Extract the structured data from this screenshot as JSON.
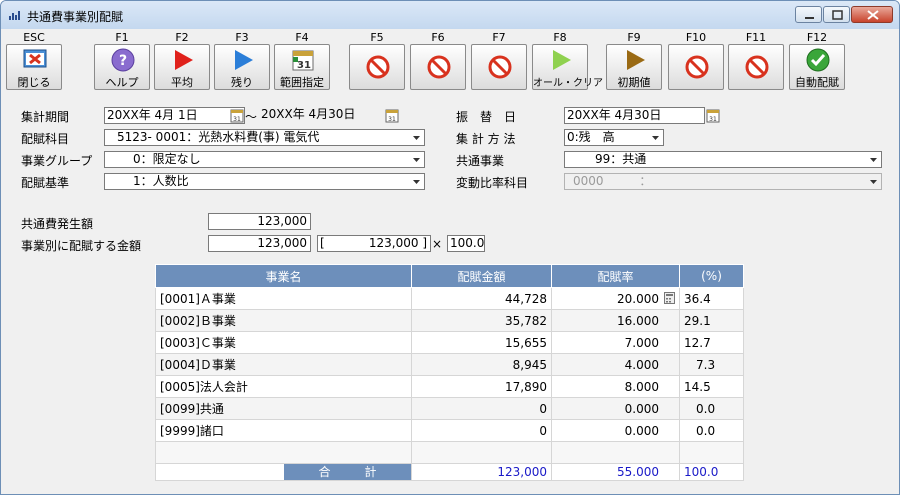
{
  "window": {
    "title": "共通費事業別配賦"
  },
  "toolbar": {
    "keys": [
      {
        "key": "ESC",
        "name": "閉じる",
        "icon": "close-window-icon"
      },
      {
        "key": "F1",
        "name": "ヘルプ",
        "icon": "help-icon"
      },
      {
        "key": "F2",
        "name": "平均",
        "icon": "play-icon"
      },
      {
        "key": "F3",
        "name": "残り",
        "icon": "play-icon"
      },
      {
        "key": "F4",
        "name": "範囲指定",
        "icon": "calendar-icon"
      },
      {
        "key": "F5",
        "name": "",
        "icon": "disabled-icon"
      },
      {
        "key": "F6",
        "name": "",
        "icon": "disabled-icon"
      },
      {
        "key": "F7",
        "name": "",
        "icon": "disabled-icon"
      },
      {
        "key": "F8",
        "name": "オール・クリア",
        "icon": "play-icon"
      },
      {
        "key": "F9",
        "name": "初期値",
        "icon": "play-icon"
      },
      {
        "key": "F10",
        "name": "",
        "icon": "disabled-icon"
      },
      {
        "key": "F11",
        "name": "",
        "icon": "disabled-icon"
      },
      {
        "key": "F12",
        "name": "自動配賦",
        "icon": "check-icon"
      }
    ],
    "colors": {
      "play_f2": "#e0211b",
      "play_f3": "#2b7ed8",
      "play_f8": "#8fd14f",
      "play_f9": "#9a6a14",
      "disabled": "#d8321e",
      "check": "#3aa63a"
    }
  },
  "form": {
    "period": {
      "label": "集計期間",
      "from": "20XX年 4月 1日",
      "to": "20XX年 4月30日"
    },
    "account": {
      "label": "配賦科目",
      "value": "5123- 0001：光熱水料費(事) 電気代"
    },
    "group": {
      "label": "事業グループ",
      "value": "0：限定なし"
    },
    "basis": {
      "label": "配賦基準",
      "value": "1：人数比"
    },
    "transfer_date": {
      "label": "振　替　日",
      "value": "20XX年 4月30日"
    },
    "method": {
      "label": "集 計 方 法",
      "value": "0:残　高"
    },
    "common_business": {
      "label": "共通事業",
      "value": "99：共通"
    },
    "variable_account": {
      "label": "変動比率科目",
      "code": "0000",
      "sep": "："
    },
    "common_amount": {
      "label": "共通費発生額",
      "value": "123,000"
    },
    "allocation_amount": {
      "label": "事業別に配賦する金額",
      "value": "123,000",
      "bracket_value": "123,000",
      "bracket_open": "[",
      "bracket_close": "]",
      "times": "×",
      "rate": "100.0"
    }
  },
  "table": {
    "headers": [
      "事業名",
      "配賦金額",
      "配賦率",
      "(%)"
    ],
    "rows": [
      {
        "name": "[0001]Ａ事業",
        "amount": "44,728",
        "rate": "20.000",
        "pct": "36.4"
      },
      {
        "name": "[0002]Ｂ事業",
        "amount": "35,782",
        "rate": "16.000",
        "pct": "29.1"
      },
      {
        "name": "[0003]Ｃ事業",
        "amount": "15,655",
        "rate": "7.000",
        "pct": "12.7"
      },
      {
        "name": "[0004]Ｄ事業",
        "amount": "8,945",
        "rate": "4.000",
        "pct": "7.3"
      },
      {
        "name": "[0005]法人会計",
        "amount": "17,890",
        "rate": "8.000",
        "pct": "14.5"
      },
      {
        "name": "[0099]共通",
        "amount": "0",
        "rate": "0.000",
        "pct": "0.0"
      },
      {
        "name": "[9999]諸口",
        "amount": "0",
        "rate": "0.000",
        "pct": "0.0"
      }
    ],
    "total": {
      "label": "合計",
      "amount": "123,000",
      "rate": "55.000",
      "pct": "100.0"
    }
  }
}
